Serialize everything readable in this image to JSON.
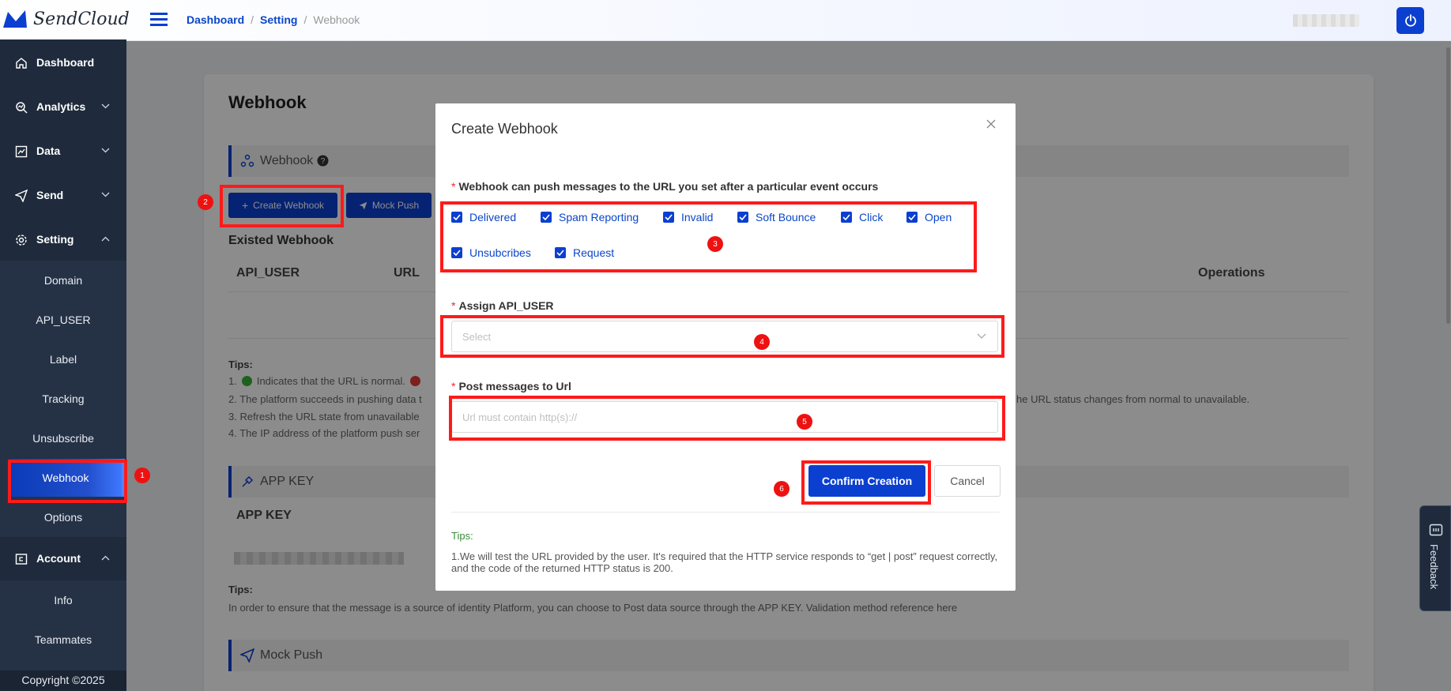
{
  "app": {
    "logo_text": "SendCloud"
  },
  "breadcrumb": {
    "items": [
      "Dashboard",
      "Setting",
      "Webhook"
    ],
    "separator": "/"
  },
  "sidebar": {
    "main_items": [
      {
        "label": "Dashboard",
        "icon": "home-icon"
      },
      {
        "label": "Analytics",
        "icon": "analytics-icon"
      },
      {
        "label": "Data",
        "icon": "chart-icon"
      },
      {
        "label": "Send",
        "icon": "send-icon"
      },
      {
        "label": "Setting",
        "icon": "gear-icon"
      }
    ],
    "setting_sub_items": [
      "Domain",
      "API_USER",
      "Label",
      "Tracking",
      "Unsubscribe",
      "Webhook",
      "Options"
    ],
    "account_label": "Account",
    "account_sub_items": [
      "Info",
      "Teammates"
    ],
    "copyright": "Copyright ©2025",
    "active_item": "Webhook"
  },
  "page": {
    "title": "Webhook",
    "webhook_section": "Webhook",
    "create_button": "Create Webhook",
    "mock_push_button": "Mock Push",
    "existed_title": "Existed Webhook",
    "columns": [
      "API_USER",
      "URL",
      "Operations"
    ],
    "tips_label": "Tips:",
    "tips": [
      "1.",
      "Indicates that the URL is normal.",
      "2. The platform succeeds in pushing data t",
      "he URL status changes from normal to unavailable.",
      "3. Refresh the URL state from unavailable",
      "4. The IP address of the platform push ser"
    ],
    "app_key_section": "APP KEY",
    "app_key_header": "APP KEY",
    "app_key_tips_label": "Tips:",
    "app_key_tips": "In order to ensure that the message is a source of identity Platform, you can choose to Post data source through the APP KEY.  Validation method reference here",
    "mock_push_section": "Mock Push"
  },
  "modal": {
    "title": "Create Webhook",
    "events_label": "Webhook can push messages to the URL you set after a particular event occurs",
    "events": [
      {
        "label": "Delivered",
        "checked": true
      },
      {
        "label": "Spam Reporting",
        "checked": true
      },
      {
        "label": "Invalid",
        "checked": true
      },
      {
        "label": "Soft Bounce",
        "checked": true
      },
      {
        "label": "Click",
        "checked": true
      },
      {
        "label": "Open",
        "checked": true
      },
      {
        "label": "Unsubcribes",
        "checked": true
      },
      {
        "label": "Request",
        "checked": true
      }
    ],
    "api_user_label": "Assign API_USER",
    "api_user_placeholder": "Select",
    "url_label": "Post messages to Url",
    "url_placeholder": "Url must contain http(s)://",
    "confirm_button": "Confirm Creation",
    "cancel_button": "Cancel",
    "tips_label": "Tips:",
    "tips_text": "1.We will test the URL provided by the user. It's required that the HTTP service responds to “get | post” request correctly, and the code of the returned HTTP status is 200."
  },
  "annotations": [
    "1",
    "2",
    "3",
    "4",
    "5",
    "6"
  ],
  "feedback": {
    "label": "Feedback"
  },
  "colors": {
    "primary": "#0b3fd0",
    "sidebar": "#1f2b3c",
    "annotation": "#ff1a1a"
  }
}
